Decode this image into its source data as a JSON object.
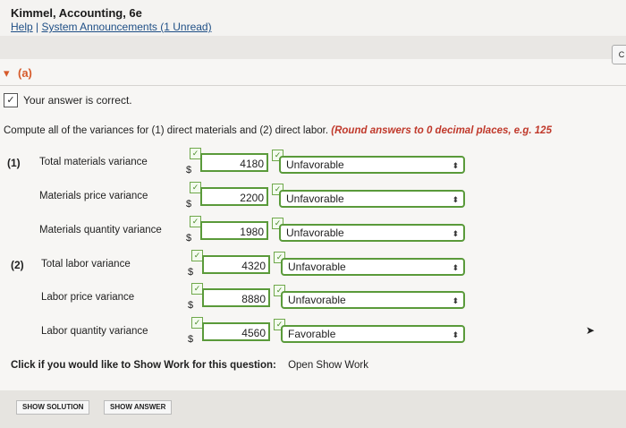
{
  "header": {
    "course_title": "Kimmel, Accounting, 6e",
    "help": "Help",
    "separator": "|",
    "announcements": "System Announcements (1 Unread)"
  },
  "section": {
    "toggle_icon": "▾",
    "label": "(a)",
    "correct_check": "✓",
    "correct_text": "Your answer is correct."
  },
  "question": {
    "instruction": "Compute all of the variances for (1) direct materials and (2) direct labor.",
    "round_note": "(Round answers to 0 decimal places, e.g. 125"
  },
  "rows": [
    {
      "num": "(1)",
      "label": "Total materials variance",
      "dollar": "$",
      "amount": "4180",
      "status": "Unfavorable"
    },
    {
      "num": "",
      "label": "Materials price variance",
      "dollar": "$",
      "amount": "2200",
      "status": "Unfavorable"
    },
    {
      "num": "",
      "label": "Materials quantity variance",
      "dollar": "$",
      "amount": "1980",
      "status": "Unfavorable"
    },
    {
      "num": "(2)",
      "label": "Total labor variance",
      "dollar": "$",
      "amount": "4320",
      "status": "Unfavorable"
    },
    {
      "num": "",
      "label": "Labor price variance",
      "dollar": "$",
      "amount": "8880",
      "status": "Unfavorable"
    },
    {
      "num": "",
      "label": "Labor quantity variance",
      "dollar": "$",
      "amount": "4560",
      "status": "Favorable"
    }
  ],
  "show_work": {
    "prompt": "Click if you would like to Show Work for this question:",
    "link": "Open Show Work"
  },
  "buttons": {
    "show_solution": "SHOW SOLUTION",
    "show_answer": "SHOW ANSWER"
  },
  "side_button": "C"
}
